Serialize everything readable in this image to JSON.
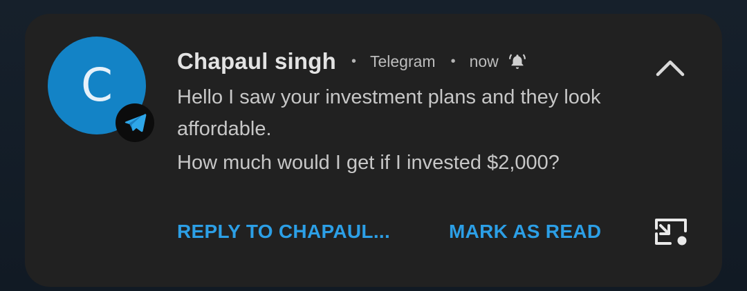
{
  "notification": {
    "avatar_letter": "C",
    "avatar_color": "#1383c6",
    "app_badge_icon": "telegram-plane-icon",
    "sender": "Chapaul singh",
    "separator": "•",
    "app_name": "Telegram",
    "time": "now",
    "alert_icon": "bell-ringing-icon",
    "expand_icon": "chevron-up-icon",
    "message": {
      "line1": "Hello I saw your investment plans and they look affordable.",
      "line2": "How much would I get if I invested $2,000?"
    },
    "actions": {
      "reply_label": "REPLY TO CHAPAUL...",
      "mark_read_label": "MARK AS READ",
      "pip_icon": "picture-in-picture-icon"
    },
    "accent_color": "#2c9fe6",
    "background_color": "#212121"
  }
}
